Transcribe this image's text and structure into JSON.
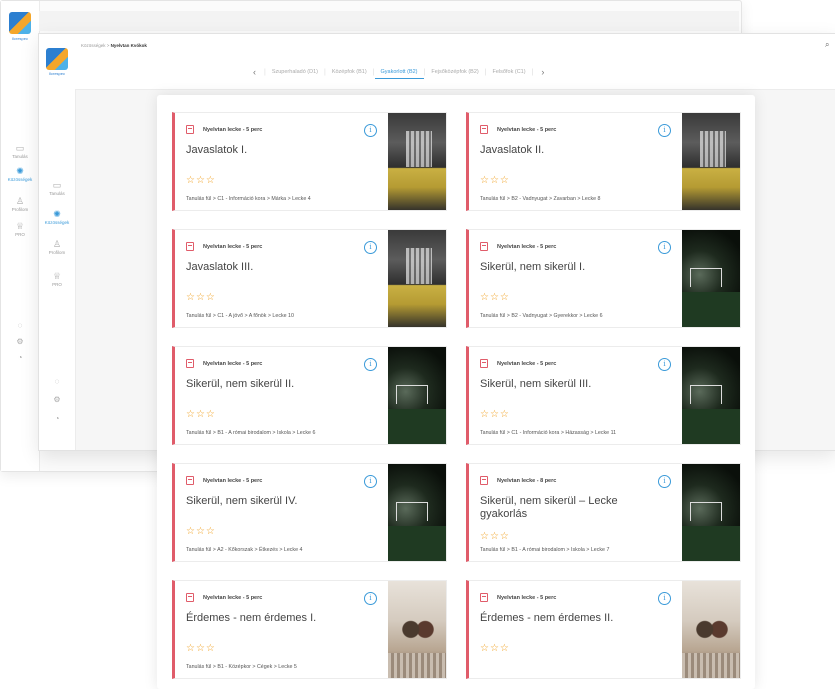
{
  "app": {
    "name": "Ilcrespec"
  },
  "back_nav": [
    {
      "label": "Tanulás",
      "icon": "book-icon"
    },
    {
      "label": "Közösségek",
      "icon": "people-icon",
      "active": true
    },
    {
      "label": "Profilom",
      "icon": "user-icon"
    },
    {
      "label": "PRO",
      "icon": "crown-icon"
    }
  ],
  "front_nav": [
    {
      "label": "Tanulás",
      "icon": "book-icon"
    },
    {
      "label": "Közösségek",
      "icon": "people-icon",
      "active": true
    },
    {
      "label": "Profilom",
      "icon": "user-icon"
    },
    {
      "label": "PRO",
      "icon": "crown-icon"
    }
  ],
  "breadcrumb": {
    "parent": "Közösségek",
    "separator": " > ",
    "current": "Nyelvtan Kvókok"
  },
  "tabs": [
    {
      "label": "Szuperhaladó (D1)"
    },
    {
      "label": "Középfok (B1)"
    },
    {
      "label": "Gyakorlott (B2)",
      "active": true
    },
    {
      "label": "Fejsőközépfok (B2)"
    },
    {
      "label": "Felsőfok (C1)"
    }
  ],
  "colors": {
    "accent": "#3a9ad9",
    "card_border": "#e05c6a",
    "stars": "#f0a020"
  },
  "cards": [
    {
      "tag": "Nyelvtan lecke - 5 perc",
      "title": "Javaslatok I.",
      "stars": "☆☆☆",
      "path": "Tanulás fül > C1 - Információ kora > Márka > Lecke 4",
      "thumb": "cafe"
    },
    {
      "tag": "Nyelvtan lecke - 5 perc",
      "title": "Javaslatok II.",
      "stars": "☆☆☆",
      "path": "Tanulás fül > B2 - Vadnyugat > Zavarban > Lecke 8",
      "thumb": "cafe"
    },
    {
      "tag": "Nyelvtan lecke - 5 perc",
      "title": "Javaslatok III.",
      "stars": "☆☆☆",
      "path": "Tanulás fül > C1 - A jövő > A főnök > Lecke 10",
      "thumb": "cafe"
    },
    {
      "tag": "Nyelvtan lecke - 5 perc",
      "title": "Sikerül, nem sikerül I.",
      "stars": "☆☆☆",
      "path": "Tanulás fül > B2 - Vadnyugat > Gyerekkor > Lecke 6",
      "thumb": "soccer"
    },
    {
      "tag": "Nyelvtan lecke - 5 perc",
      "title": "Sikerül, nem sikerül II.",
      "stars": "☆☆☆",
      "path": "Tanulás fül > B1 - A római birodalom > Iskola > Lecke 6",
      "thumb": "soccer"
    },
    {
      "tag": "Nyelvtan lecke - 5 perc",
      "title": "Sikerül, nem sikerül III.",
      "stars": "☆☆☆",
      "path": "Tanulás fül > C1 - Információ kora > Házasság > Lecke 11",
      "thumb": "soccer"
    },
    {
      "tag": "Nyelvtan lecke - 5 perc",
      "title": "Sikerül, nem sikerül IV.",
      "stars": "☆☆☆",
      "path": "Tanulás fül > A2 - Kőkorszak > Étkezés > Lecke 4",
      "thumb": "soccer"
    },
    {
      "tag": "Nyelvtan lecke - 8 perc",
      "title": "Sikerül, nem sikerül – Lecke gyakorlás",
      "stars": "☆☆☆",
      "path": "Tanulás fül > B1 - A római birodalom > Iskola > Lecke 7",
      "thumb": "soccer"
    },
    {
      "tag": "Nyelvtan lecke - 5 perc",
      "title": "Érdemes - nem érdemes I.",
      "stars": "☆☆☆",
      "path": "Tanulás fül > B1 - Középkor > Cégek > Lecke 5",
      "thumb": "couple"
    },
    {
      "tag": "Nyelvtan lecke - 5 perc",
      "title": "Érdemes - nem érdemes II.",
      "stars": "☆☆☆",
      "path": "",
      "thumb": "couple"
    }
  ]
}
